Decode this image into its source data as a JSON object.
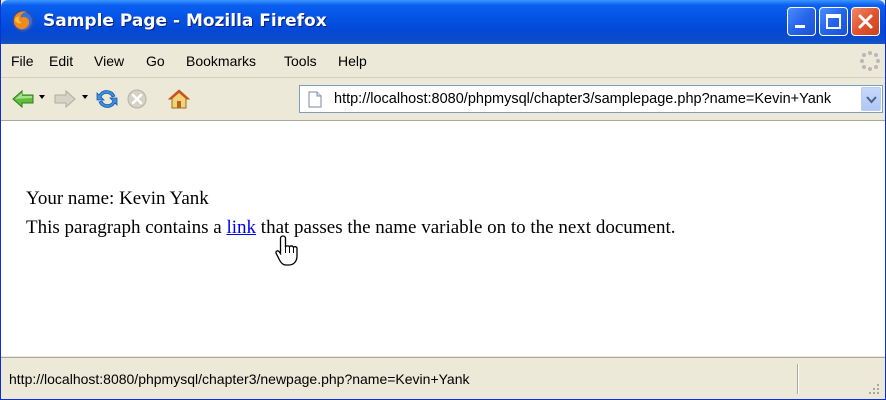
{
  "window": {
    "title": "Sample Page - Mozilla Firefox",
    "app_icon": "firefox-icon",
    "controls": [
      "minimize-icon",
      "maximize-icon",
      "close-icon"
    ]
  },
  "menu": {
    "items": [
      {
        "label": "File"
      },
      {
        "label": "Edit"
      },
      {
        "label": "View"
      },
      {
        "label": "Go"
      },
      {
        "label": "Bookmarks"
      },
      {
        "label": "Tools"
      },
      {
        "label": "Help"
      }
    ]
  },
  "toolbar": {
    "buttons": [
      "back-arrow-icon",
      "forward-arrow-icon",
      "reload-icon",
      "stop-icon",
      "home-icon"
    ],
    "url": "http://localhost:8080/phpmysql/chapter3/samplepage.php?name=Kevin+Yank"
  },
  "page": {
    "line1": "Your name: Kevin Yank",
    "line2_before": "This paragraph contains a ",
    "link_text": "link",
    "line2_after": " that passes the name variable on to the next document."
  },
  "status": {
    "text": "http://localhost:8080/phpmysql/chapter3/newpage.php?name=Kevin+Yank"
  },
  "colors": {
    "titlebar": "#0553e3",
    "link": "#0000ee",
    "chrome": "#ece9d8",
    "close_button": "#e15530"
  }
}
